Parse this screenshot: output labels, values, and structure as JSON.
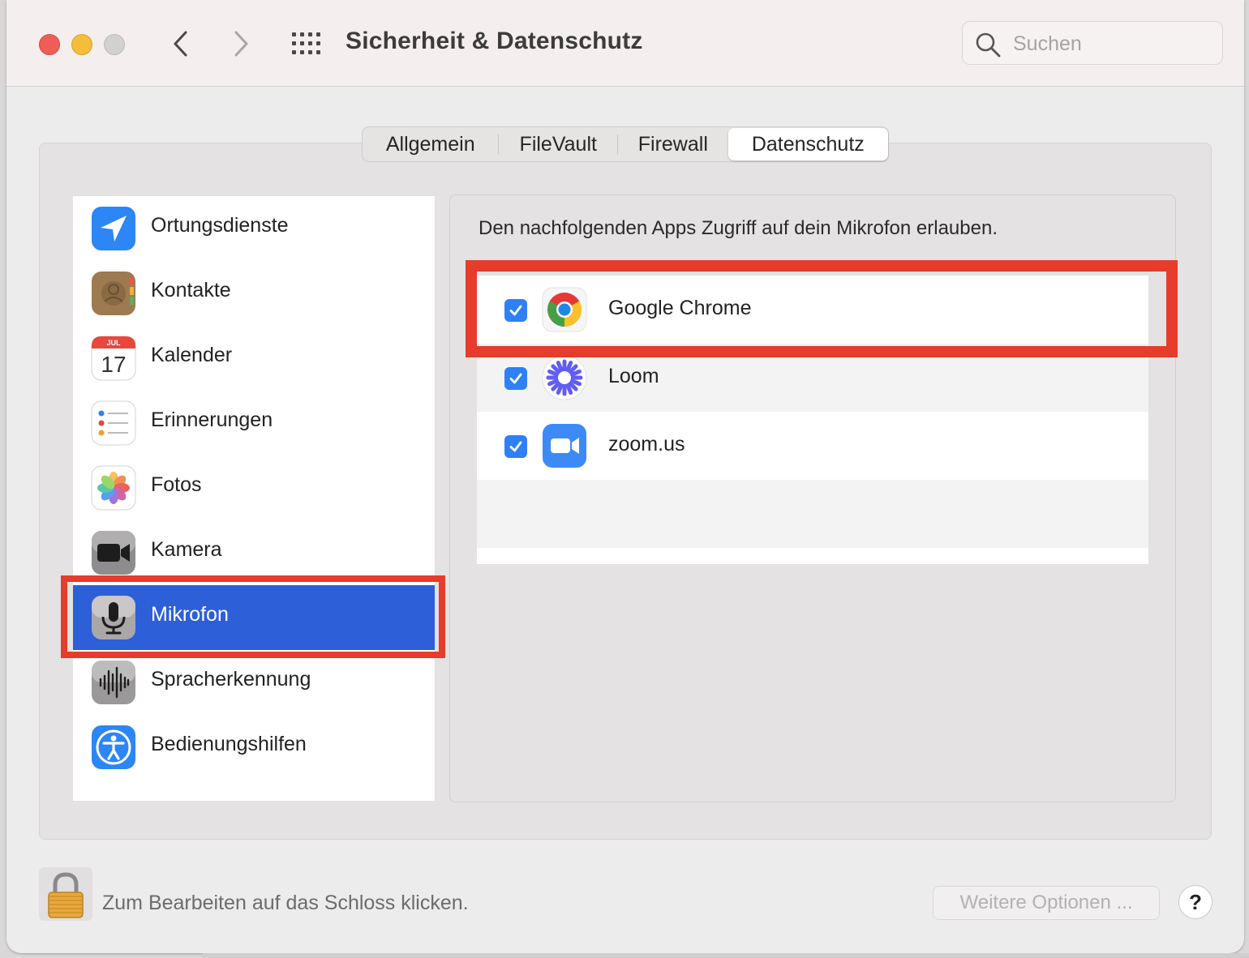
{
  "window": {
    "title": "Sicherheit & Datenschutz",
    "search_placeholder": "Suchen"
  },
  "tabs": [
    {
      "label": "Allgemein",
      "selected": false
    },
    {
      "label": "FileVault",
      "selected": false
    },
    {
      "label": "Firewall",
      "selected": false
    },
    {
      "label": "Datenschutz",
      "selected": true
    }
  ],
  "sidebar": {
    "items": [
      {
        "label": "Ortungsdienste",
        "icon": "location-arrow-icon"
      },
      {
        "label": "Kontakte",
        "icon": "contacts-icon"
      },
      {
        "label": "Kalender",
        "icon": "calendar-icon",
        "icon_month": "JUL",
        "icon_day": "17"
      },
      {
        "label": "Erinnerungen",
        "icon": "reminders-icon"
      },
      {
        "label": "Fotos",
        "icon": "photos-icon"
      },
      {
        "label": "Kamera",
        "icon": "camera-icon"
      },
      {
        "label": "Mikrofon",
        "icon": "microphone-icon",
        "selected": true
      },
      {
        "label": "Spracherkennung",
        "icon": "speech-recognition-icon"
      },
      {
        "label": "Bedienungshilfen",
        "icon": "accessibility-icon"
      }
    ]
  },
  "permissions": {
    "description": "Den nachfolgenden Apps Zugriff auf dein Mikrofon erlauben.",
    "apps": [
      {
        "name": "Google Chrome",
        "checked": true,
        "icon": "chrome-icon"
      },
      {
        "name": "Loom",
        "checked": true,
        "icon": "loom-icon"
      },
      {
        "name": "zoom.us",
        "checked": true,
        "icon": "zoom-icon"
      }
    ]
  },
  "footer": {
    "lock_text": "Zum Bearbeiten auf das Schloss klicken.",
    "options_label": "Weitere Optionen ...",
    "help_label": "?"
  },
  "colors": {
    "selection": "#2d5fd8",
    "highlight": "#e53c2c",
    "checkbox": "#2f7ff6"
  }
}
